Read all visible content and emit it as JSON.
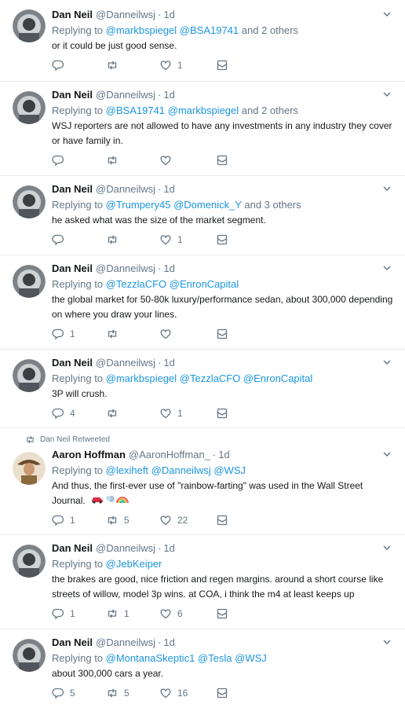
{
  "tweets": [
    {
      "name": "Dan Neil",
      "handle": "@Danneilwsj",
      "time": "1d",
      "reply_prefix": "Replying to ",
      "mention1": "@markbspiegel",
      "mention2": "@BSA19741",
      "reply_suffix": " and 2 others",
      "text": "or it could be just good sense.",
      "replies": "",
      "retweets": "",
      "likes": "1"
    },
    {
      "name": "Dan Neil",
      "handle": "@Danneilwsj",
      "time": "1d",
      "reply_prefix": "Replying to ",
      "mention1": "@BSA19741",
      "mention2": "@markbspiegel",
      "reply_suffix": " and 2 others",
      "text": "WSJ reporters are not allowed to have any investments in any industry they cover or have family in.",
      "replies": "",
      "retweets": "",
      "likes": ""
    },
    {
      "name": "Dan Neil",
      "handle": "@Danneilwsj",
      "time": "1d",
      "reply_prefix": "Replying to ",
      "mention1": "@Trumpery45",
      "mention2": "@Domenick_Y",
      "reply_suffix": " and 3 others",
      "text": "he asked what was the size of the market segment.",
      "replies": "",
      "retweets": "",
      "likes": "1"
    },
    {
      "name": "Dan Neil",
      "handle": "@Danneilwsj",
      "time": "1d",
      "reply_prefix": "Replying to ",
      "mention1": "@TezzlaCFO",
      "mention2": "@EnronCapital",
      "reply_suffix": "",
      "text": "the global market for 50-80k luxury/performance sedan, about 300,000 depending on where you draw your lines.",
      "replies": "1",
      "retweets": "",
      "likes": ""
    },
    {
      "name": "Dan Neil",
      "handle": "@Danneilwsj",
      "time": "1d",
      "reply_prefix": "Replying to ",
      "mention1": "@markbspiegel",
      "mention2": "@TezzlaCFO",
      "mention3": "@EnronCapital",
      "reply_suffix": "",
      "text": "3P will crush.",
      "replies": "4",
      "retweets": "",
      "likes": "1"
    },
    {
      "retweeted_by": "Dan Neil Retweeted",
      "name": "Aaron Hoffman",
      "handle": "@AaronHoffman_",
      "time": "1d",
      "reply_prefix": "Replying to ",
      "mention1": "@lexiheft",
      "mention2": "@Danneilwsj",
      "mention3": "@WSJ",
      "reply_suffix": "",
      "text": "And thus, the first-ever use of \"rainbow-farting\" was used in the Wall Street Journal.",
      "replies": "1",
      "retweets": "5",
      "likes": "22"
    },
    {
      "name": "Dan Neil",
      "handle": "@Danneilwsj",
      "time": "1d",
      "reply_prefix": "Replying to ",
      "mention1": "@JebKeiper",
      "reply_suffix": "",
      "text": "the brakes are good, nice friction and regen margins. around a short course like streets of willow, model 3p wins. at COA, i think the m4 at least keeps up",
      "replies": "1",
      "retweets": "1",
      "likes": "6"
    },
    {
      "name": "Dan Neil",
      "handle": "@Danneilwsj",
      "time": "1d",
      "reply_prefix": "Replying to ",
      "mention1": "@MontanaSkeptic1",
      "mention2": "@Tesla",
      "mention3": "@WSJ",
      "reply_suffix": "",
      "text": "about 300,000 cars a year.",
      "replies": "5",
      "retweets": "5",
      "likes": "16"
    }
  ],
  "colors": {
    "link": "#1b95e0",
    "muted": "#657786",
    "text": "#14171a",
    "border": "#e6ecf0"
  },
  "icons": {
    "reply": "reply-icon",
    "retweet": "retweet-icon",
    "like": "heart-icon",
    "dm": "envelope-icon",
    "caret": "chevron-down-icon"
  }
}
